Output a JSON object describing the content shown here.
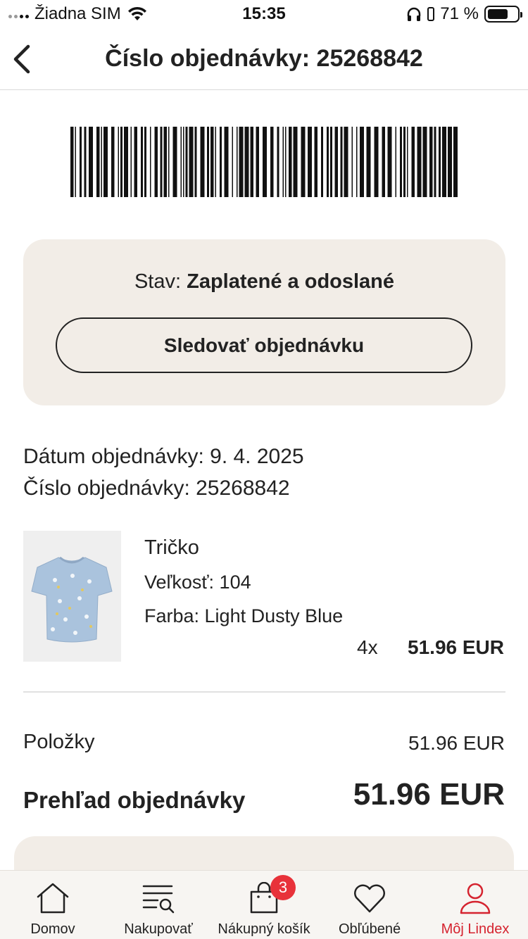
{
  "status_bar": {
    "carrier": "Žiadna SIM",
    "time": "15:35",
    "battery": "71 %",
    "battery_level": 0.71
  },
  "header": {
    "title": "Číslo objednávky: 25268842"
  },
  "status_card": {
    "status_prefix": "Stav:",
    "status_value": "Zaplatené a odoslané",
    "track_button": "Sledovať objednávku"
  },
  "order": {
    "date_line": "Dátum objednávky: 9. 4. 2025",
    "number_line": "Číslo objednávky: 25268842"
  },
  "product": {
    "name": "Tričko",
    "size": "Veľkosť: 104",
    "color": "Farba: Light Dusty Blue",
    "quantity": "4x",
    "price": "51.96 EUR"
  },
  "totals": {
    "items_label": "Položky",
    "items_value": "51.96 EUR",
    "summary_label": "Prehľad objednávky",
    "summary_value": "51.96 EUR"
  },
  "tab_bar": {
    "tabs": [
      {
        "label": "Domov",
        "icon": "home-icon"
      },
      {
        "label": "Nakupovať",
        "icon": "search-list-icon"
      },
      {
        "label": "Nákupný košík",
        "icon": "shopping-bag-icon",
        "badge": "3"
      },
      {
        "label": "Obľúbené",
        "icon": "heart-icon"
      },
      {
        "label": "Môj Lindex",
        "icon": "user-icon",
        "active": true
      }
    ]
  },
  "colors": {
    "accent": "#d5232f",
    "card_bg": "#f2ede7",
    "badge": "#e8323a"
  }
}
